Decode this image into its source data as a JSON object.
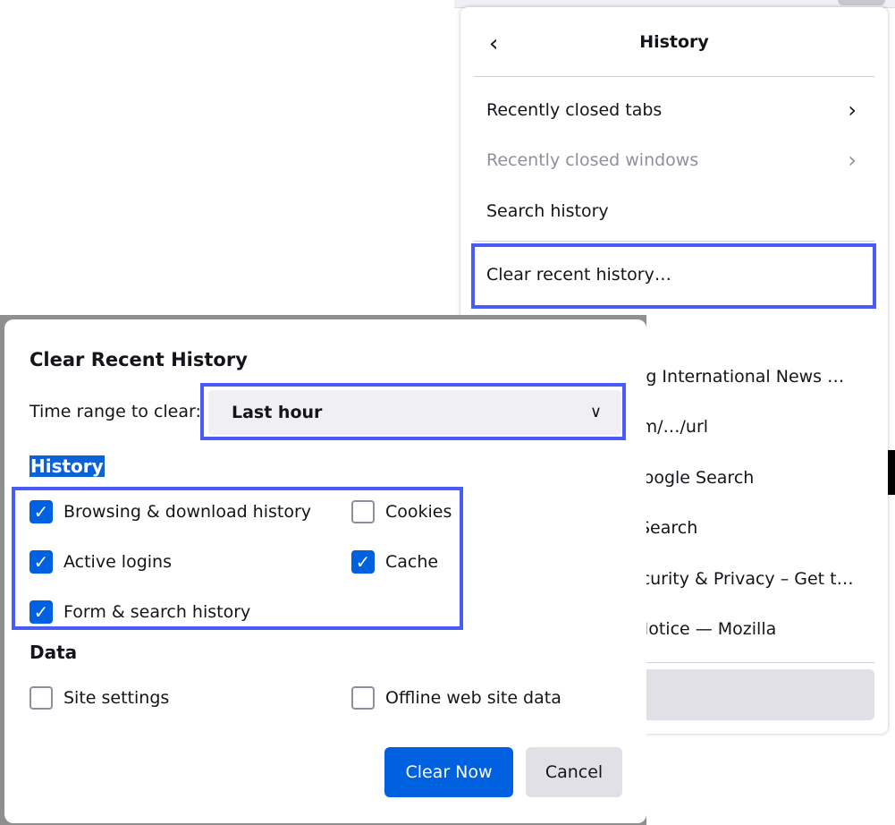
{
  "panel": {
    "title": "History",
    "items": [
      {
        "label": "Recently closed tabs",
        "enabled": true
      },
      {
        "label": "Recently closed windows",
        "enabled": false
      },
      {
        "label": "Search history"
      },
      {
        "label": "Clear recent history…"
      }
    ],
    "history_entries": [
      "ing International News …",
      "om/…/url",
      "Google Search",
      " Search",
      "ecurity & Privacy – Get t…",
      " Notice — Mozilla"
    ]
  },
  "dialog": {
    "title": "Clear Recent History",
    "time_range_label": "Time range to clear:",
    "time_range_value": "Last hour",
    "history_section": "History",
    "data_section": "Data",
    "history_options": [
      {
        "label": "Browsing & download history",
        "checked": true
      },
      {
        "label": "Cookies",
        "checked": false
      },
      {
        "label": "Active logins",
        "checked": true
      },
      {
        "label": "Cache",
        "checked": true
      },
      {
        "label": "Form & search history",
        "checked": true
      }
    ],
    "data_options": [
      {
        "label": "Site settings",
        "checked": false
      },
      {
        "label": "Offline web site data",
        "checked": false
      }
    ],
    "clear_button": "Clear Now",
    "cancel_button": "Cancel"
  },
  "colors": {
    "accent": "#0061e0",
    "highlight": "#4a5cf7"
  }
}
